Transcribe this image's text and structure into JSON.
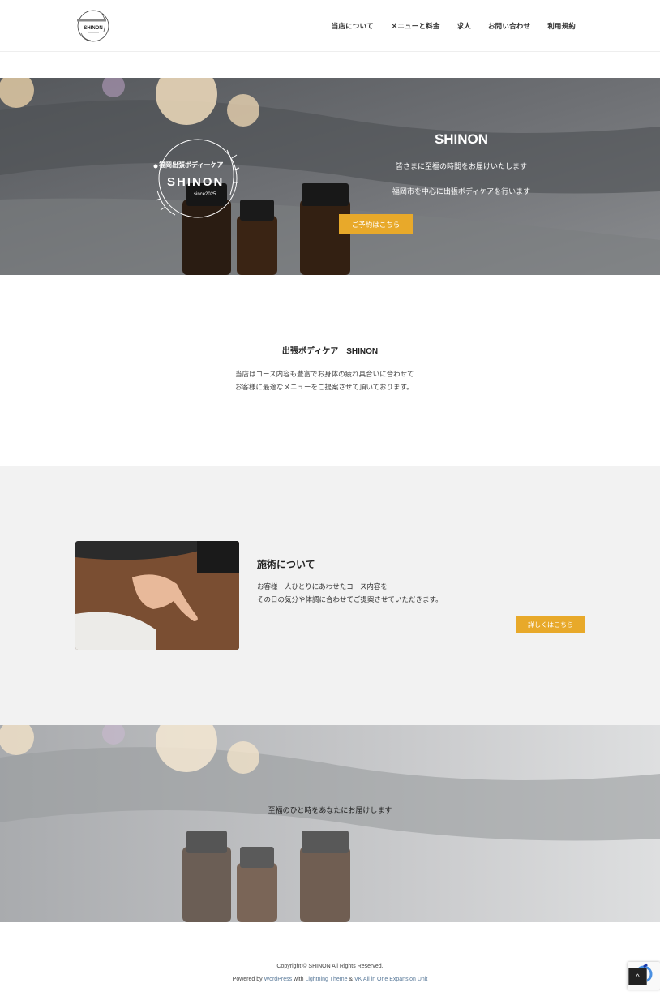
{
  "header": {
    "logo_alt": "SHINON",
    "nav": [
      "当店について",
      "メニューと料金",
      "求人",
      "お問い合わせ",
      "利用規約"
    ]
  },
  "hero": {
    "logo_top": "福岡出張ボディーケア",
    "logo_name": "SHINON",
    "logo_since": "since2025",
    "title": "SHINON",
    "line1": "皆さまに至福の時間をお届けいたします",
    "line2": "福岡市を中心に出張ボディケアを行います",
    "button": "ご予約はこちら"
  },
  "intro": {
    "title": "出張ボディケア　SHINON",
    "line1": "当店はコース内容も豊富でお身体の疲れ具合いに合わせて",
    "line2": "お客様に最適なメニューをご提案させて頂いております。"
  },
  "about": {
    "title": "施術について",
    "line1": "お客様一人ひとりにあわせたコース内容を",
    "line2": "その日の気分や体調に合わせてご提案させていただきます。",
    "button": "詳しくはこちら"
  },
  "banner": {
    "text": "至福のひと時をあなたにお届けします"
  },
  "footer": {
    "copyright": "Copyright © SHINON All Rights Reserved.",
    "powered_prefix": "Powered by ",
    "wordpress": "WordPress",
    "with": " with ",
    "theme": "Lightning Theme",
    "amp": " & ",
    "plugin": "VK All in One Expansion Unit",
    "to_top": "^"
  },
  "colors": {
    "accent": "#e8a92a",
    "section_bg": "#f2f2f2"
  }
}
